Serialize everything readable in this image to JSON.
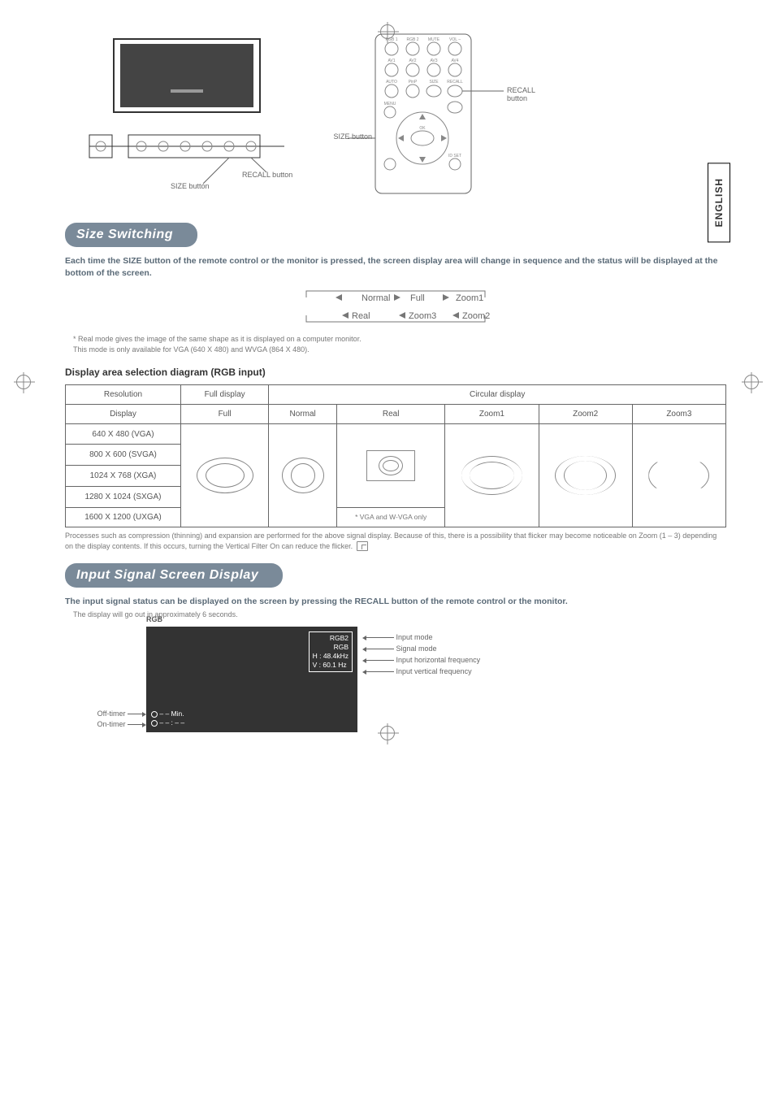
{
  "lang_tab": "ENGLISH",
  "diagrams": {
    "recall_label": "RECALL button",
    "size_label": "SIZE button",
    "remote_buttons": {
      "row1": [
        "RGB 1",
        "RGB 2",
        "MUTE",
        "VOL –"
      ],
      "row2": [
        "AV1",
        "AV2",
        "AV3",
        "AV4"
      ],
      "row3": [
        "AUTO",
        "PinP",
        "SIZE",
        "RECALL"
      ],
      "menu": "MENU",
      "ok": "OK",
      "idset": "ID SET"
    }
  },
  "section1": {
    "heading": "Size Switching",
    "lead": "Each time the SIZE button of the remote control or the monitor is pressed, the screen display area will change in sequence and the status will be displayed at the bottom of the screen.",
    "cycle_top": [
      "Normal",
      "Full",
      "Zoom1"
    ],
    "cycle_bottom": [
      "Real",
      "Zoom3",
      "Zoom2"
    ],
    "footnote_lines": [
      "* Real mode gives the image of the same shape as it is displayed on a computer monitor.",
      "This mode is only available for VGA (640 X 480) and WVGA (864 X 480)."
    ],
    "sub_heading": "Display area selection diagram (RGB input)",
    "table": {
      "header1": [
        "Resolution",
        "Full display",
        "Circular display"
      ],
      "header2": [
        "Display",
        "Full",
        "Normal",
        "Real",
        "Zoom1",
        "Zoom2",
        "Zoom3"
      ],
      "rows": [
        "640 X 480 (VGA)",
        "800 X 600 (SVGA)",
        "1024 X 768 (XGA)",
        "1280 X 1024 (SXGA)",
        "1600 X 1200 (UXGA)"
      ],
      "real_note": "* VGA and W-VGA only"
    },
    "table_note": "Processes such as compression (thinning) and expansion are performed for the above signal display. Because of this, there is a possibility that flicker may become noticeable on Zoom (1 – 3) depending on the display contents. If this occurs, turning the Vertical Filter On           can reduce the flicker."
  },
  "section2": {
    "heading": "Input Signal Screen Display",
    "lead": "The input signal status can be displayed on the screen by pressing the RECALL button of the remote control or the monitor.",
    "subline": "The display will go out in approximately 6 seconds.",
    "rgb_title": "RGB",
    "info_box": [
      "RGB2",
      "RGB",
      "H : 48.4kHz",
      "V : 60.1 Hz"
    ],
    "timer": [
      "– – Min.",
      "– – : – –"
    ],
    "callouts": {
      "input_mode": "Input mode",
      "signal_mode": "Signal mode",
      "h_freq": "Input horizontal frequency",
      "v_freq": "Input vertical frequency",
      "off_timer": "Off-timer",
      "on_timer": "On-timer"
    }
  }
}
